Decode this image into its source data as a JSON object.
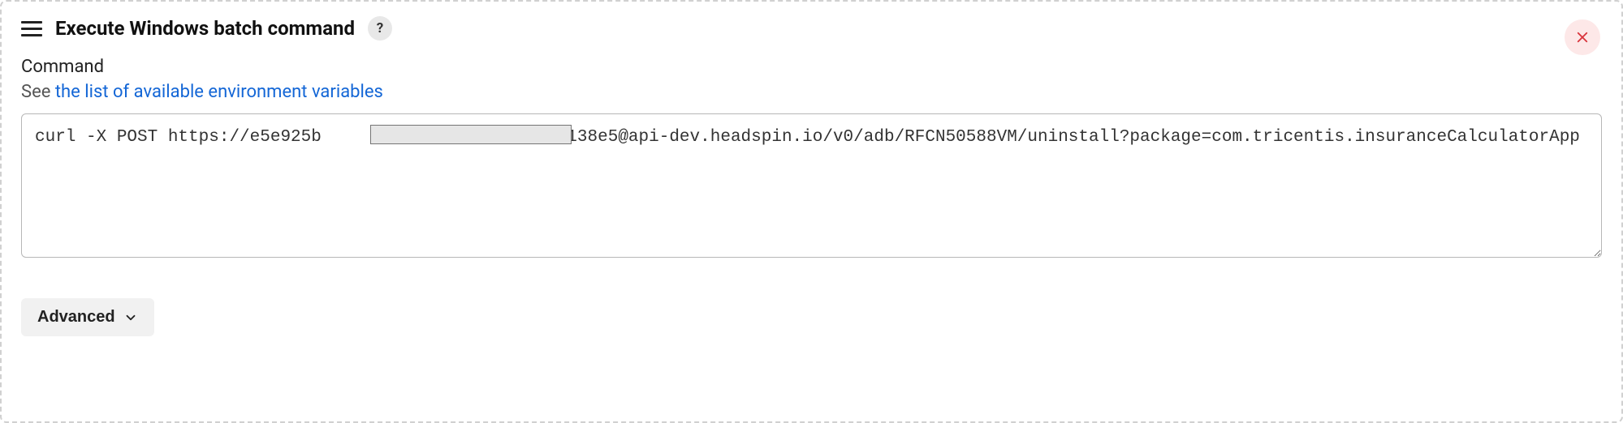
{
  "step": {
    "title": "Execute Windows batch command",
    "help_symbol": "?"
  },
  "field": {
    "label": "Command",
    "help_prefix": "See ",
    "help_link_text": "the list of available environment variables",
    "value": "curl -X POST https://e5e925b                     151138e5@api-dev.headspin.io/v0/adb/RFCN50588VM/uninstall?package=com.tricentis.insuranceCalculatorApp"
  },
  "buttons": {
    "advanced": "Advanced"
  }
}
